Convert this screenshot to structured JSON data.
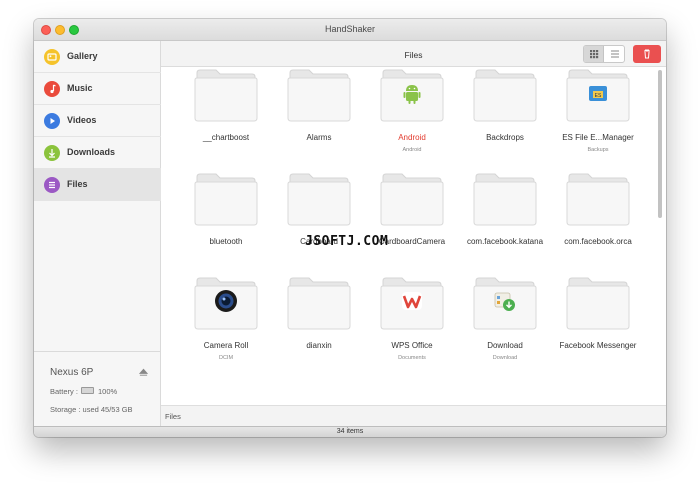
{
  "window": {
    "title": "HandShaker"
  },
  "sidebar": {
    "items": [
      {
        "label": "Gallery",
        "icon": "gallery-icon",
        "color": "#f5c32b",
        "active": false
      },
      {
        "label": "Music",
        "icon": "music-icon",
        "color": "#ea4b3c",
        "active": false
      },
      {
        "label": "Videos",
        "icon": "videos-icon",
        "color": "#3c7be0",
        "active": false
      },
      {
        "label": "Downloads",
        "icon": "downloads-icon",
        "color": "#8bc33c",
        "active": false
      },
      {
        "label": "Files",
        "icon": "files-icon",
        "color": "#9b59c4",
        "active": true
      }
    ]
  },
  "device": {
    "name": "Nexus 6P",
    "battery_label": "Battery :",
    "battery_value": "100%",
    "storage_label": "Storage : used 45/53 GB"
  },
  "header": {
    "title": "Files"
  },
  "files": [
    {
      "name": "__chartboost",
      "sub": "",
      "icon": "folder-icon"
    },
    {
      "name": "Alarms",
      "sub": "",
      "icon": "folder-icon"
    },
    {
      "name": "Android",
      "sub": "Android",
      "icon": "android-folder-icon",
      "highlight": true
    },
    {
      "name": "Backdrops",
      "sub": "",
      "icon": "folder-icon"
    },
    {
      "name": "ES File E...Manager",
      "sub": "Backups",
      "icon": "es-file-explorer-folder-icon"
    },
    {
      "name": "bluetooth",
      "sub": "",
      "icon": "folder-icon"
    },
    {
      "name": "Cardboard",
      "sub": "",
      "icon": "folder-icon"
    },
    {
      "name": "CardboardCamera",
      "sub": "",
      "icon": "folder-icon"
    },
    {
      "name": "com.facebook.katana",
      "sub": "",
      "icon": "folder-icon"
    },
    {
      "name": "com.facebook.orca",
      "sub": "",
      "icon": "folder-icon"
    },
    {
      "name": "Camera Roll",
      "sub": "DCIM",
      "icon": "camera-folder-icon"
    },
    {
      "name": "dianxin",
      "sub": "",
      "icon": "folder-icon"
    },
    {
      "name": "WPS Office",
      "sub": "Documents",
      "icon": "wps-office-folder-icon"
    },
    {
      "name": "Download",
      "sub": "Download",
      "icon": "download-folder-icon"
    },
    {
      "name": "Facebook Messenger",
      "sub": "",
      "icon": "folder-icon"
    }
  ],
  "path_bar": {
    "text": "Files"
  },
  "status": {
    "text": "34 items"
  },
  "watermark": "JSOFTJ.COM",
  "colors": {
    "accent_red": "#e33b2e",
    "delete_button": "#ea5050"
  }
}
